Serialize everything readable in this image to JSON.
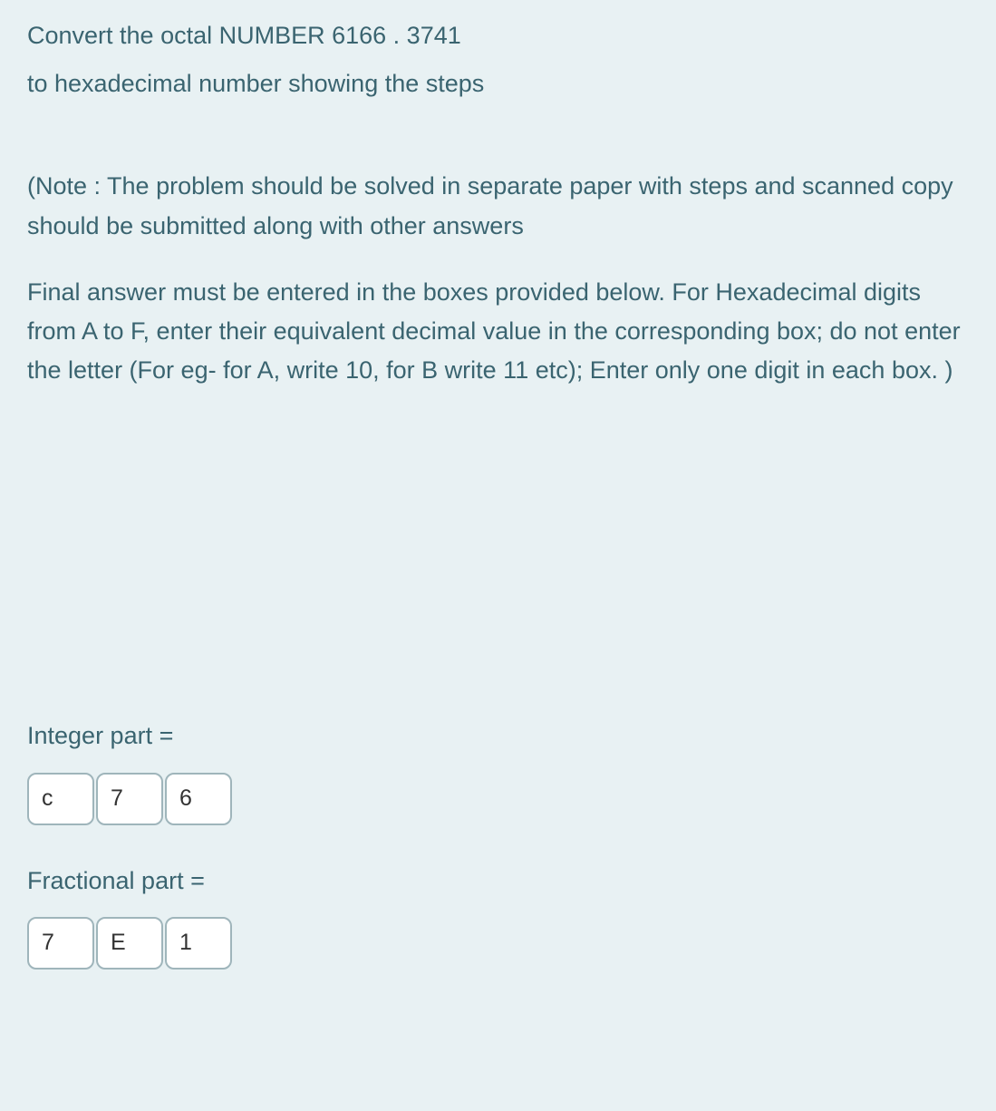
{
  "question": {
    "line1": "Convert the octal NUMBER  6166 .  3741",
    "line2": "to hexadecimal  number showing the steps"
  },
  "note": "(Note :   The problem should be solved  in separate paper with steps  and scanned copy should be submitted along with other answers",
  "instruction": "Final answer must be entered in the boxes provided below. For Hexadecimal digits from A to F, enter their equivalent decimal value in the corresponding box; do not enter the letter (For eg- for A, write 10, for B write 11 etc);  Enter only one digit in each box. )",
  "integer": {
    "label": "Integer part =",
    "digits": [
      "c",
      "7",
      "6"
    ]
  },
  "fractional": {
    "label": "Fractional part =",
    "digits": [
      "7",
      "E",
      "1"
    ]
  }
}
